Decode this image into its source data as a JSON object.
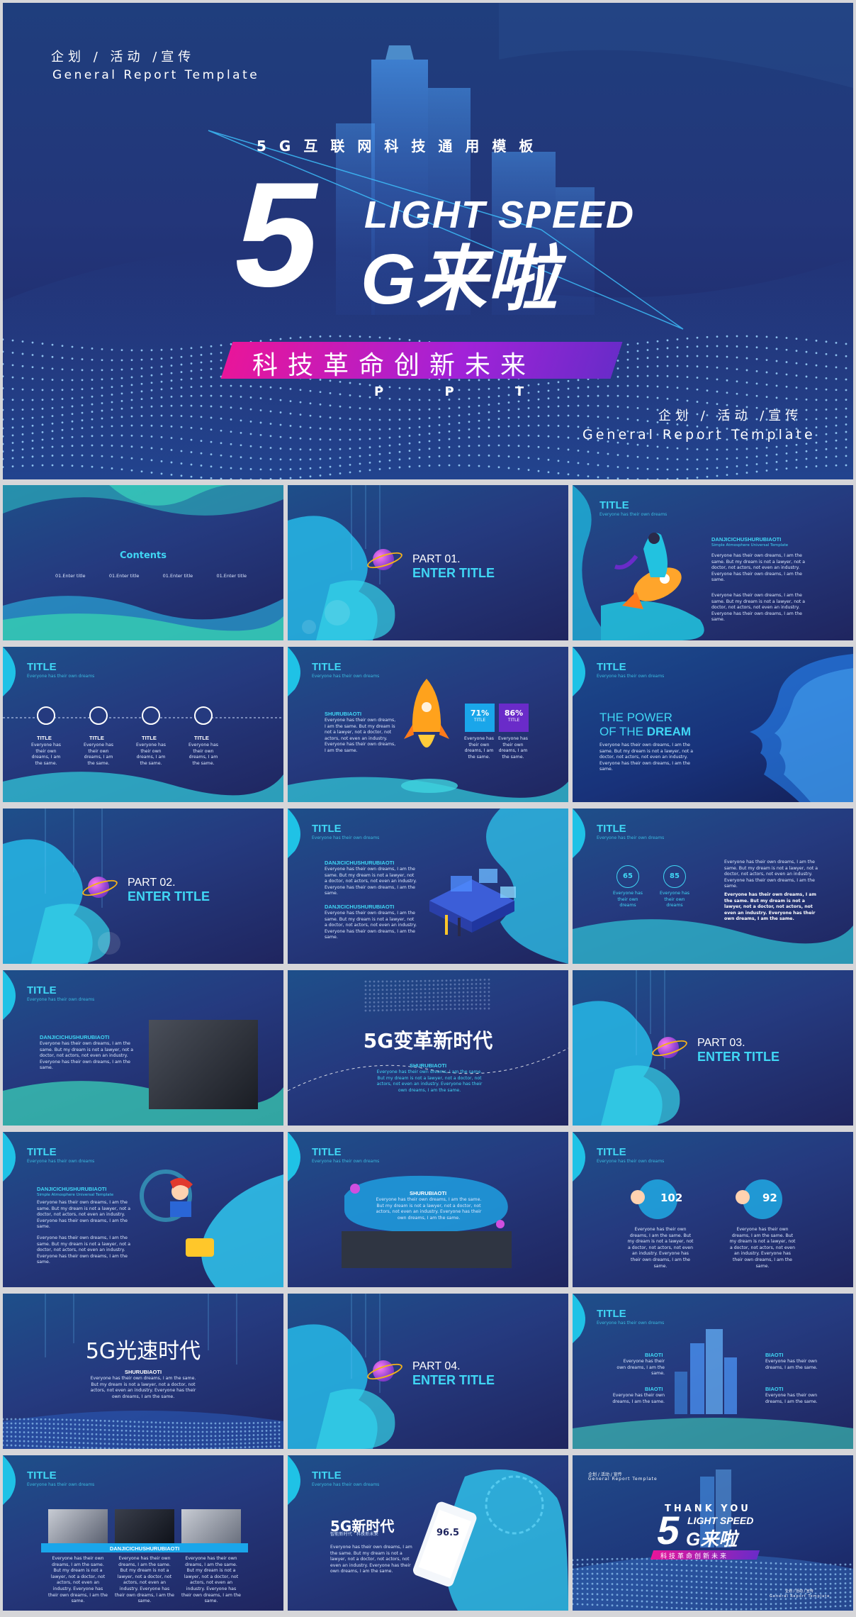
{
  "hero": {
    "top_left_cn": "企划 / 活动 /宣传",
    "top_left_en": "General Report Template",
    "kicker": "5G互联网科技通用模板",
    "big5": "5",
    "light_speed": "LIGHT SPEED",
    "gcome": "G来啦",
    "banner": "科技革命创新未来",
    "ppt": "P P T",
    "bottom_right_cn": "企划 / 活动 /宣传",
    "bottom_right_en": "General Report Template"
  },
  "contents": {
    "title": "Contents",
    "items": [
      "01.Enter title",
      "01.Enter title",
      "01.Enter title",
      "01.Enter title"
    ]
  },
  "part1": {
    "no": "PART 01.",
    "title": "ENTER TITLE"
  },
  "part2": {
    "no": "PART 02.",
    "title": "ENTER TITLE"
  },
  "part3": {
    "no": "PART 03.",
    "title": "ENTER TITLE"
  },
  "part4": {
    "no": "PART 04.",
    "title": "ENTER TITLE"
  },
  "common": {
    "title": "TITLE",
    "sub": "Everyone has their own dreams",
    "body": "Everyone has their own dreams, I am the same. But my dream is not a lawyer, not a doctor, not actors, not even an industry. Everyone has their own dreams, I am the same.",
    "short": "Everyone has their own dreams, I am the same.",
    "danji": "DANJICICHUSHURUBIAOTI",
    "danji_sub": "Simple Atmosphere Universal Template",
    "shuru": "SHURUBIAOTI",
    "biaoti": "BIAOTI"
  },
  "icons_slide": {
    "labels": [
      "TITLE",
      "TITLE",
      "TITLE",
      "TITLE"
    ]
  },
  "rocket_slide": {
    "pct1": "71%",
    "pct2": "86%",
    "pct_label": "TITLE"
  },
  "power_slide": {
    "line1": "THE POWER",
    "line2a": "OF THE ",
    "line2b": "DREAM"
  },
  "circles_slide": {
    "v1": "65",
    "v2": "85"
  },
  "era_slide": {
    "title": "5G变革新时代"
  },
  "speed_slide": {
    "title": "5G光速时代"
  },
  "nums_slide": {
    "v1": "102",
    "v2": "92"
  },
  "phone_slide": {
    "title": "5G新时代",
    "sub": "智能新时代 · 科技新未来",
    "value": "96.5"
  },
  "thanks": {
    "cn": "企划 / 活动 / 宣传",
    "en": "General Report Template",
    "thank": "THANK YOU",
    "light": "LIGHT SPEED",
    "big5": "5",
    "gcome": "G来啦",
    "banner": "科技革命创新未来",
    "br_cn": "企划 / 活动 / 宣传",
    "br_en": "General Report Template"
  },
  "colors": {
    "accent": "#40d7f5",
    "magenta": "#e0148c",
    "purple": "#6a2bc9",
    "bg_dark": "#1f255f"
  }
}
